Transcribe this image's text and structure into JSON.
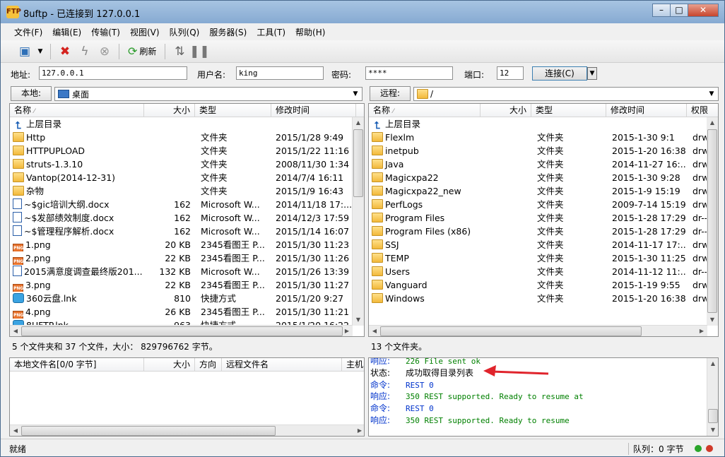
{
  "window": {
    "title": "8uftp - 已连接到 127.0.0.1",
    "app_icon_text": "FTP"
  },
  "menu": [
    "文件(F)",
    "编辑(E)",
    "传输(T)",
    "视图(V)",
    "队列(Q)",
    "服务器(S)",
    "工具(T)",
    "帮助(H)"
  ],
  "toolbar": {
    "refresh_label": "刷新"
  },
  "connection": {
    "address_label": "地址:",
    "address_value": "127.0.0.1",
    "username_label": "用户名:",
    "username_value": "king",
    "password_label": "密码:",
    "password_value": "****",
    "port_label": "端口:",
    "port_value": "12",
    "connect_label": "连接(C)"
  },
  "local": {
    "path_label": "本地:",
    "path_value": "桌面",
    "columns": {
      "name": "名称",
      "size": "大小",
      "type": "类型",
      "modified": "修改时间"
    },
    "up_label": "上层目录",
    "files": [
      {
        "name": "Http",
        "size": "",
        "type": "文件夹",
        "modified": "2015/1/28 9:49",
        "icon": "folder"
      },
      {
        "name": "HTTPUPLOAD",
        "size": "",
        "type": "文件夹",
        "modified": "2015/1/22 11:16",
        "icon": "folder"
      },
      {
        "name": "struts-1.3.10",
        "size": "",
        "type": "文件夹",
        "modified": "2008/11/30 1:34",
        "icon": "folder"
      },
      {
        "name": "Vantop(2014-12-31)",
        "size": "",
        "type": "文件夹",
        "modified": "2014/7/4 16:11",
        "icon": "folder"
      },
      {
        "name": "杂物",
        "size": "",
        "type": "文件夹",
        "modified": "2015/1/9 16:43",
        "icon": "folder"
      },
      {
        "name": "~$gic培训大纲.docx",
        "size": "162",
        "type": "Microsoft W...",
        "modified": "2014/11/18 17:...",
        "icon": "doc"
      },
      {
        "name": "~$发部绩效制度.docx",
        "size": "162",
        "type": "Microsoft W...",
        "modified": "2014/12/3 17:59",
        "icon": "doc"
      },
      {
        "name": "~$管理程序解析.docx",
        "size": "162",
        "type": "Microsoft W...",
        "modified": "2015/1/14 16:07",
        "icon": "doc"
      },
      {
        "name": "1.png",
        "size": "20 KB",
        "type": "2345看图王 P...",
        "modified": "2015/1/30 11:23",
        "icon": "png"
      },
      {
        "name": "2.png",
        "size": "22 KB",
        "type": "2345看图王 P...",
        "modified": "2015/1/30 11:26",
        "icon": "png"
      },
      {
        "name": "2015满意度调查最终版201...",
        "size": "132 KB",
        "type": "Microsoft W...",
        "modified": "2015/1/26 13:39",
        "icon": "doc"
      },
      {
        "name": "3.png",
        "size": "22 KB",
        "type": "2345看图王 P...",
        "modified": "2015/1/30 11:27",
        "icon": "png"
      },
      {
        "name": "360云盘.lnk",
        "size": "810",
        "type": "快捷方式",
        "modified": "2015/1/20 9:27",
        "icon": "lnk"
      },
      {
        "name": "4.png",
        "size": "26 KB",
        "type": "2345看图王 P...",
        "modified": "2015/1/30 11:21",
        "icon": "png"
      },
      {
        "name": "8UFTP.lnk",
        "size": "963",
        "type": "快捷方式",
        "modified": "2015/1/20 16:22",
        "icon": "lnk"
      }
    ],
    "summary": "5 个文件夹和 37 个文件，大小： 829796762 字节。"
  },
  "remote": {
    "path_label": "远程:",
    "path_value": "/",
    "columns": {
      "name": "名称",
      "size": "大小",
      "type": "类型",
      "modified": "修改时间",
      "perm": "权限"
    },
    "up_label": "上层目录",
    "files": [
      {
        "name": "Flexlm",
        "type": "文件夹",
        "modified": "2015-1-30 9:1",
        "perm": "drw-rw"
      },
      {
        "name": "inetpub",
        "type": "文件夹",
        "modified": "2015-1-20 16:38",
        "perm": "drw-rw"
      },
      {
        "name": "Java",
        "type": "文件夹",
        "modified": "2014-11-27 16:...",
        "perm": "drw-rw"
      },
      {
        "name": "Magicxpa22",
        "type": "文件夹",
        "modified": "2015-1-30 9:28",
        "perm": "drw-rw"
      },
      {
        "name": "Magicxpa22_new",
        "type": "文件夹",
        "modified": "2015-1-9 15:19",
        "perm": "drw-rw"
      },
      {
        "name": "PerfLogs",
        "type": "文件夹",
        "modified": "2009-7-14 15:19",
        "perm": "drw-rw"
      },
      {
        "name": "Program Files",
        "type": "文件夹",
        "modified": "2015-1-28 17:29",
        "perm": "dr--r-"
      },
      {
        "name": "Program Files (x86)",
        "type": "文件夹",
        "modified": "2015-1-28 17:29",
        "perm": "dr--r-"
      },
      {
        "name": "SSJ",
        "type": "文件夹",
        "modified": "2014-11-17 17:...",
        "perm": "drw-rw"
      },
      {
        "name": "TEMP",
        "type": "文件夹",
        "modified": "2015-1-30 11:25",
        "perm": "drw-rw"
      },
      {
        "name": "Users",
        "type": "文件夹",
        "modified": "2014-11-12 11:...",
        "perm": "dr--r-"
      },
      {
        "name": "Vanguard",
        "type": "文件夹",
        "modified": "2015-1-19 9:55",
        "perm": "drw-rw"
      },
      {
        "name": "Windows",
        "type": "文件夹",
        "modified": "2015-1-20 16:38",
        "perm": "drw-rw"
      }
    ],
    "summary": "13 个文件夹。"
  },
  "queue": {
    "columns": {
      "local": "本地文件名[0/0 字节]",
      "size": "大小",
      "direction": "方向",
      "remote": "远程文件名",
      "host": "主机"
    }
  },
  "log": [
    {
      "type": "响应:",
      "msg": "226 File sent ok",
      "kind": "resp"
    },
    {
      "type": "状态:",
      "msg": "成功取得目录列表",
      "kind": "status"
    },
    {
      "type": "命令:",
      "msg": "REST 0",
      "kind": "cmd"
    },
    {
      "type": "响应:",
      "msg": "350 REST supported. Ready to resume at",
      "kind": "resp"
    },
    {
      "type": "命令:",
      "msg": "REST 0",
      "kind": "cmd"
    },
    {
      "type": "响应:",
      "msg": "350 REST supported. Ready to resume",
      "kind": "resp"
    }
  ],
  "status": {
    "left": "就绪",
    "queue": "队列：0 字节"
  },
  "colors": {
    "status_green": "#2aa52a",
    "status_red": "#d03a2a",
    "arrow_red": "#e0242c"
  }
}
